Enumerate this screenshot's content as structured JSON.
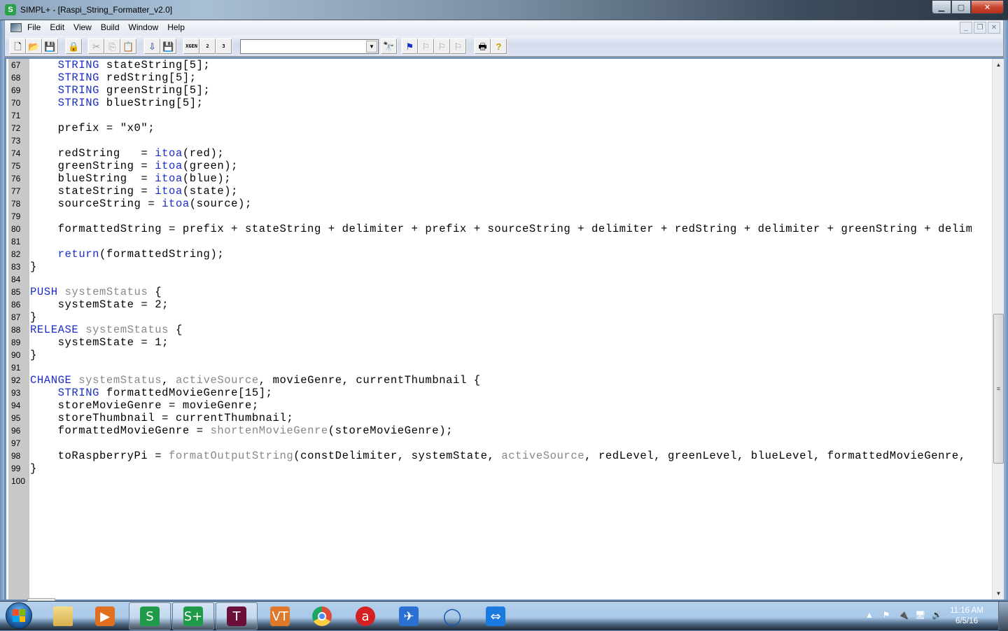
{
  "window": {
    "title": "SIMPL+ - [Raspi_String_Formatter_v2.0]",
    "app_icon_letter": "S",
    "minimize_glyph": "▁",
    "maximize_glyph": "▢",
    "close_glyph": "✕"
  },
  "menu": {
    "items": [
      "File",
      "Edit",
      "View",
      "Build",
      "Window",
      "Help"
    ],
    "mdi_minimize": "_",
    "mdi_restore": "❐",
    "mdi_close": "✕"
  },
  "toolbar": {
    "buttons": [
      {
        "name": "new-file",
        "glyph": "🗋",
        "enabled": true
      },
      {
        "name": "open-file",
        "glyph": "📂",
        "enabled": true
      },
      {
        "name": "save",
        "glyph": "💾",
        "enabled": true
      },
      {
        "name": "lock",
        "glyph": "🔒",
        "enabled": true
      },
      {
        "name": "cut",
        "glyph": "✂",
        "enabled": false
      },
      {
        "name": "copy",
        "glyph": "⎘",
        "enabled": false
      },
      {
        "name": "paste",
        "glyph": "📋",
        "enabled": true
      },
      {
        "name": "insert",
        "glyph": "⇩",
        "enabled": true
      },
      {
        "name": "save-all",
        "glyph": "💾",
        "enabled": true
      },
      {
        "name": "xgen",
        "glyph": "XGEN",
        "enabled": true
      },
      {
        "name": "compile-2",
        "glyph": "2",
        "enabled": true
      },
      {
        "name": "compile-3",
        "glyph": "3",
        "enabled": true
      },
      {
        "name": "find",
        "glyph": "🔭",
        "enabled": false
      },
      {
        "name": "bookmark",
        "glyph": "⚑",
        "enabled": true
      },
      {
        "name": "next-bookmark",
        "glyph": "⚐",
        "enabled": false
      },
      {
        "name": "prev-bookmark",
        "glyph": "⚐",
        "enabled": false
      },
      {
        "name": "clear-bookmarks",
        "glyph": "⚐",
        "enabled": false
      },
      {
        "name": "print",
        "glyph": "🖶",
        "enabled": true
      },
      {
        "name": "help",
        "glyph": "?",
        "enabled": true
      }
    ],
    "search_combo_value": "",
    "combo_arrow": "▼"
  },
  "editor": {
    "lines": [
      {
        "n": "67",
        "tokens": [
          [
            "",
            "    "
          ],
          [
            "kw",
            "STRING"
          ],
          [
            "",
            " stateString[5];"
          ]
        ]
      },
      {
        "n": "68",
        "tokens": [
          [
            "",
            "    "
          ],
          [
            "kw",
            "STRING"
          ],
          [
            "",
            " redString[5];"
          ]
        ]
      },
      {
        "n": "69",
        "tokens": [
          [
            "",
            "    "
          ],
          [
            "kw",
            "STRING"
          ],
          [
            "",
            " greenString[5];"
          ]
        ]
      },
      {
        "n": "70",
        "tokens": [
          [
            "",
            "    "
          ],
          [
            "kw",
            "STRING"
          ],
          [
            "",
            " blueString[5];"
          ]
        ]
      },
      {
        "n": "71",
        "tokens": []
      },
      {
        "n": "72",
        "tokens": [
          [
            "",
            "    prefix = \"x0\";"
          ]
        ]
      },
      {
        "n": "73",
        "tokens": []
      },
      {
        "n": "74",
        "tokens": [
          [
            "",
            "    redString   = "
          ],
          [
            "fn",
            "itoa"
          ],
          [
            "",
            "(red);"
          ]
        ]
      },
      {
        "n": "75",
        "tokens": [
          [
            "",
            "    greenString = "
          ],
          [
            "fn",
            "itoa"
          ],
          [
            "",
            "(green);"
          ]
        ]
      },
      {
        "n": "76",
        "tokens": [
          [
            "",
            "    blueString  = "
          ],
          [
            "fn",
            "itoa"
          ],
          [
            "",
            "(blue);"
          ]
        ]
      },
      {
        "n": "77",
        "tokens": [
          [
            "",
            "    stateString = "
          ],
          [
            "fn",
            "itoa"
          ],
          [
            "",
            "(state);"
          ]
        ]
      },
      {
        "n": "78",
        "tokens": [
          [
            "",
            "    sourceString = "
          ],
          [
            "fn",
            "itoa"
          ],
          [
            "",
            "(source);"
          ]
        ]
      },
      {
        "n": "79",
        "tokens": []
      },
      {
        "n": "80",
        "tokens": [
          [
            "",
            "    formattedString = prefix + stateString + delimiter + prefix + sourceString + delimiter + redString + delimiter + greenString + delimit"
          ]
        ]
      },
      {
        "n": "81",
        "tokens": []
      },
      {
        "n": "82",
        "tokens": [
          [
            "",
            "    "
          ],
          [
            "kw",
            "return"
          ],
          [
            "",
            "(formattedString);"
          ]
        ]
      },
      {
        "n": "83",
        "tokens": [
          [
            "",
            "}"
          ]
        ]
      },
      {
        "n": "84",
        "tokens": []
      },
      {
        "n": "85",
        "tokens": [
          [
            "kw",
            "PUSH"
          ],
          [
            "",
            " "
          ],
          [
            "gr",
            "systemStatus"
          ],
          [
            "",
            " {"
          ]
        ]
      },
      {
        "n": "86",
        "tokens": [
          [
            "",
            "    systemState = 2;"
          ]
        ]
      },
      {
        "n": "87",
        "tokens": [
          [
            "",
            "}"
          ]
        ]
      },
      {
        "n": "88",
        "tokens": [
          [
            "kw",
            "RELEASE"
          ],
          [
            "",
            " "
          ],
          [
            "gr",
            "systemStatus"
          ],
          [
            "",
            " {"
          ]
        ]
      },
      {
        "n": "89",
        "tokens": [
          [
            "",
            "    systemState = 1;"
          ]
        ]
      },
      {
        "n": "90",
        "tokens": [
          [
            "",
            "}"
          ]
        ]
      },
      {
        "n": "91",
        "tokens": []
      },
      {
        "n": "92",
        "tokens": [
          [
            "kw",
            "CHANGE"
          ],
          [
            "",
            " "
          ],
          [
            "gr",
            "systemStatus"
          ],
          [
            "",
            ", "
          ],
          [
            "gr",
            "activeSource"
          ],
          [
            "",
            ", movieGenre, currentThumbnail {"
          ]
        ]
      },
      {
        "n": "93",
        "tokens": [
          [
            "",
            "    "
          ],
          [
            "kw",
            "STRING"
          ],
          [
            "",
            " formattedMovieGenre[15];"
          ]
        ]
      },
      {
        "n": "94",
        "tokens": [
          [
            "",
            "    storeMovieGenre = movieGenre;"
          ]
        ]
      },
      {
        "n": "95",
        "tokens": [
          [
            "",
            "    storeThumbnail = currentThumbnail;"
          ]
        ]
      },
      {
        "n": "96",
        "tokens": [
          [
            "",
            "    formattedMovieGenre = "
          ],
          [
            "gr",
            "shortenMovieGenre"
          ],
          [
            "",
            "(storeMovieGenre);"
          ]
        ]
      },
      {
        "n": "97",
        "tokens": []
      },
      {
        "n": "98",
        "tokens": [
          [
            "",
            "    toRaspberryPi = "
          ],
          [
            "gr",
            "formatOutputString"
          ],
          [
            "",
            "(constDelimiter, systemState, "
          ],
          [
            "gr",
            "activeSource"
          ],
          [
            "",
            ", redLevel, greenLevel, blueLevel, formattedMovieGenre, st"
          ]
        ]
      },
      {
        "n": "99",
        "tokens": [
          [
            "",
            "}"
          ]
        ]
      },
      {
        "n": "100",
        "tokens": []
      }
    ],
    "scroll_up_glyph": "▲",
    "scroll_down_glyph": "▼",
    "scroll_thumb_glyph": "≡"
  },
  "colors": {
    "keyword": "#1a2ccc",
    "user_function": "#888888",
    "gutter": "#c8c8c8"
  },
  "taskbar": {
    "apps": [
      {
        "name": "windows-explorer",
        "label": "",
        "color": "#e8c060",
        "active": false
      },
      {
        "name": "media-player",
        "label": "▶",
        "color": "#e07020",
        "active": false
      },
      {
        "name": "simpl-windows",
        "label": "S",
        "color": "#1e9a48",
        "active": true
      },
      {
        "name": "simpl-plus",
        "label": "S+",
        "color": "#1e9a48",
        "active": true
      },
      {
        "name": "toolbox",
        "label": "T",
        "color": "#6a0f3a",
        "active": true
      },
      {
        "name": "vtpro",
        "label": "VT",
        "color": "#e0782a",
        "active": false
      },
      {
        "name": "chrome",
        "label": "",
        "color": "#dd4b39",
        "active": false
      },
      {
        "name": "app-a",
        "label": "a",
        "color": "#d42020",
        "active": false
      },
      {
        "name": "flight-app",
        "label": "✈",
        "color": "#2a70d0",
        "active": false
      },
      {
        "name": "chat-app",
        "label": "◯",
        "color": "#1a5aa8",
        "active": false
      },
      {
        "name": "teamviewer",
        "label": "⇔",
        "color": "#1a7ae0",
        "active": false
      }
    ],
    "tray_icons": [
      "▲",
      "⚑",
      "🔌",
      "🖥",
      "🔊"
    ],
    "clock_time": "11:16 AM",
    "clock_date": "6/5/16"
  }
}
